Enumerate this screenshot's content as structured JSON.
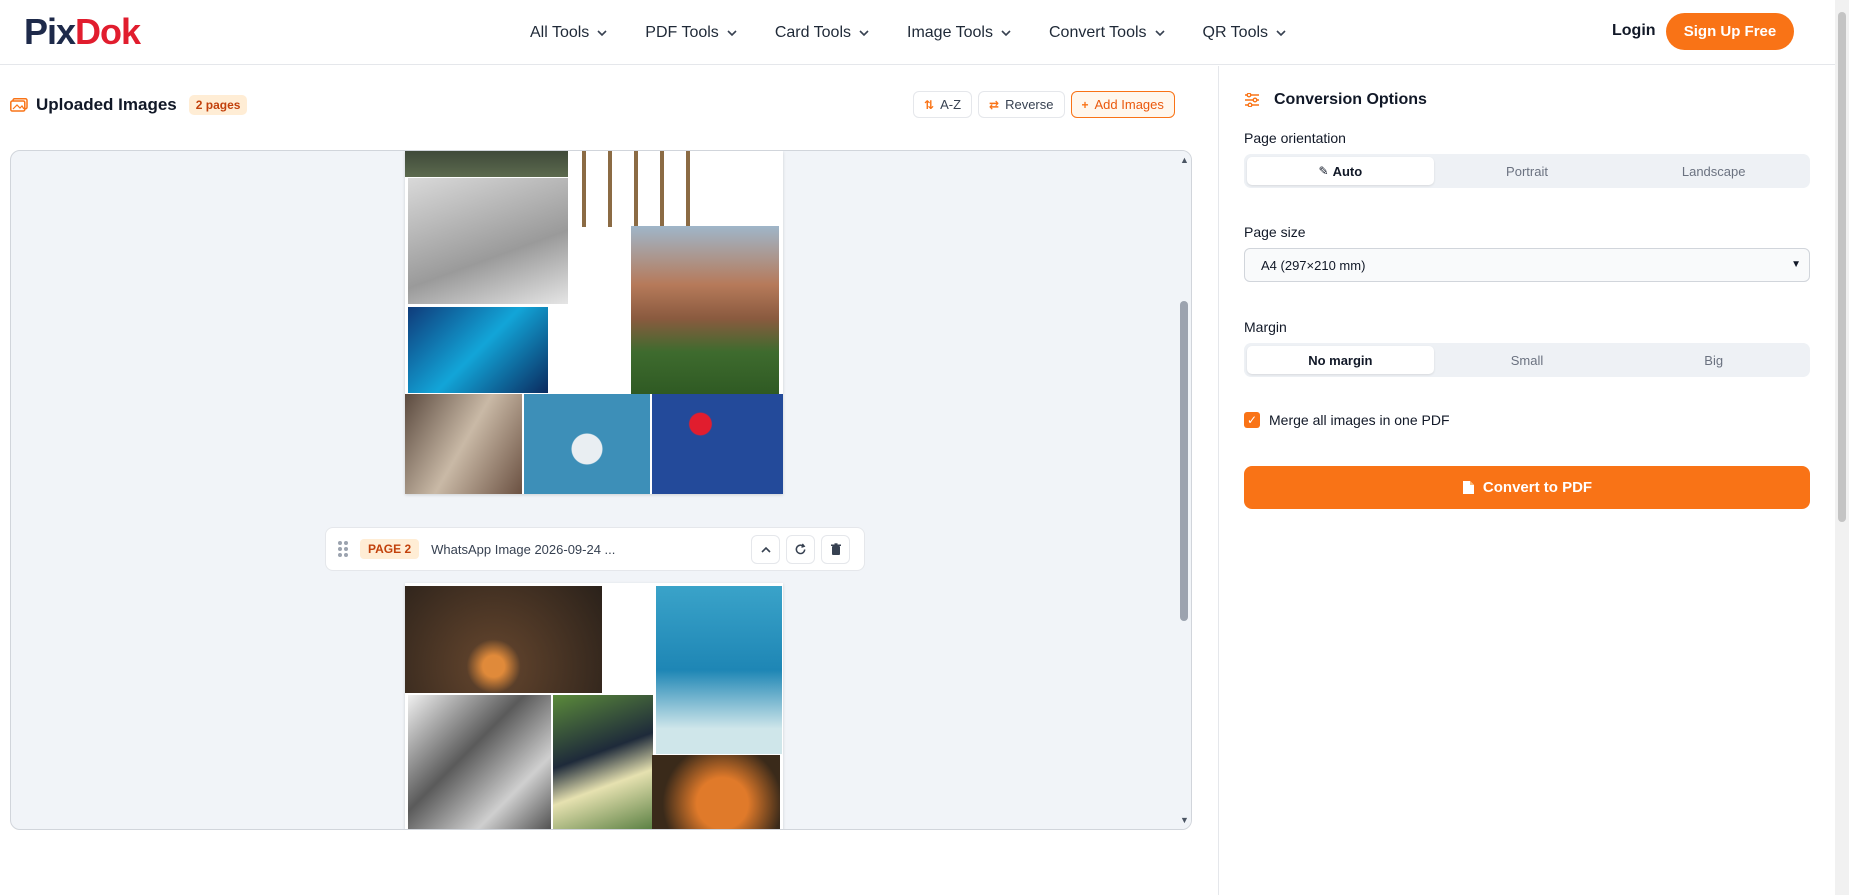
{
  "header": {
    "logo_text_a": "Pix",
    "logo_text_b": "Dok",
    "nav": [
      {
        "label": "All Tools"
      },
      {
        "label": "PDF Tools"
      },
      {
        "label": "Card Tools"
      },
      {
        "label": "Image Tools"
      },
      {
        "label": "Convert Tools"
      },
      {
        "label": "QR Tools"
      }
    ],
    "login": "Login",
    "signup": "Sign Up Free"
  },
  "left": {
    "title": "Uploaded Images",
    "pages_badge": "2 pages",
    "sort_label": "A-Z",
    "reverse_label": "Reverse",
    "add_label": "Add Images",
    "page2": {
      "tag": "PAGE 2",
      "filename": "WhatsApp Image 2026-09-24 ..."
    }
  },
  "right": {
    "title": "Conversion Options",
    "orientation_label": "Page orientation",
    "orientation_options": [
      "Auto",
      "Portrait",
      "Landscape"
    ],
    "orientation_selected": "Auto",
    "size_label": "Page size",
    "size_value": "A4 (297×210 mm)",
    "margin_label": "Margin",
    "margin_options": [
      "No margin",
      "Small",
      "Big"
    ],
    "margin_selected": "No margin",
    "merge_label": "Merge all images in one PDF",
    "merge_checked": true,
    "convert_label": "Convert to PDF"
  },
  "colors": {
    "accent": "#f97316",
    "logo_red": "#e11d2e"
  }
}
